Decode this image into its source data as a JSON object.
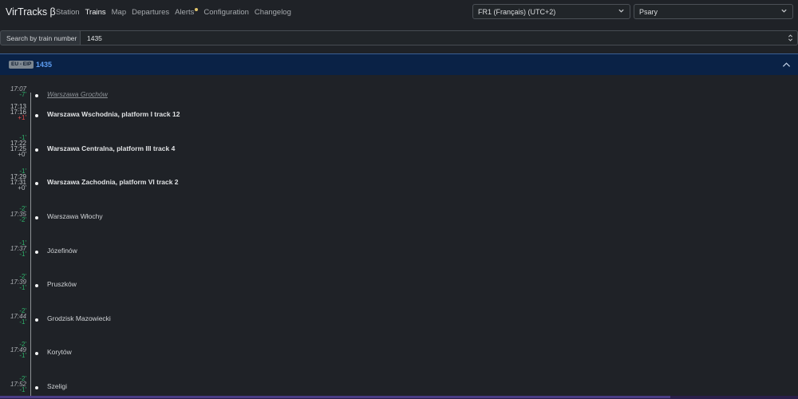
{
  "nav": {
    "brand": "VirTracks β",
    "links": [
      "Station",
      "Trains",
      "Map",
      "Departures",
      "Alerts",
      "Configuration",
      "Changelog"
    ],
    "active": "Trains"
  },
  "selects": {
    "timezone": "FR1 (Français) (UTC+2)",
    "station": "Psary"
  },
  "search": {
    "label": "Search by train number",
    "value": "1435"
  },
  "train": {
    "badge": "EU - EIP",
    "number": "1435"
  },
  "stops": [
    {
      "name": "Warszawa Grochów",
      "style": "ital",
      "times": [
        {
          "v": "17:07",
          "c": "ital"
        },
        {
          "v": "-7'",
          "c": "d-green"
        }
      ]
    },
    {
      "name": "Warszawa Wschodnia, platform I track 12",
      "style": "bold",
      "times": [
        {
          "v": "17:13",
          "c": ""
        },
        {
          "v": "17:16",
          "c": ""
        },
        {
          "v": "+1'",
          "c": "d-red"
        }
      ]
    },
    {
      "name": "Warszawa Centralna, platform III track 4",
      "style": "bold",
      "times": [
        {
          "v": "-1'",
          "c": "d-green"
        },
        {
          "v": "17:22",
          "c": ""
        },
        {
          "v": "17:25",
          "c": ""
        },
        {
          "v": "+0'",
          "c": "d-gray"
        }
      ]
    },
    {
      "name": "Warszawa Zachodnia, platform VI track 2",
      "style": "bold",
      "times": [
        {
          "v": "-1'",
          "c": "d-green"
        },
        {
          "v": "17:29",
          "c": ""
        },
        {
          "v": "17:31",
          "c": ""
        },
        {
          "v": "+0'",
          "c": "d-gray"
        }
      ]
    },
    {
      "name": "Warszawa Włochy",
      "style": "",
      "times": [
        {
          "v": "-2'",
          "c": "d-green"
        },
        {
          "v": "17:35",
          "c": "ital"
        },
        {
          "v": "-2'",
          "c": "d-green"
        }
      ]
    },
    {
      "name": "Józefinów",
      "style": "",
      "times": [
        {
          "v": "-1'",
          "c": "d-green"
        },
        {
          "v": "17:37",
          "c": "ital"
        },
        {
          "v": "-1'",
          "c": "d-green"
        }
      ]
    },
    {
      "name": "Pruszków",
      "style": "",
      "times": [
        {
          "v": "-2'",
          "c": "d-green"
        },
        {
          "v": "17:39",
          "c": "ital"
        },
        {
          "v": "-1'",
          "c": "d-green"
        }
      ]
    },
    {
      "name": "Grodzisk Mazowiecki",
      "style": "",
      "times": [
        {
          "v": "-2'",
          "c": "d-green"
        },
        {
          "v": "17:44",
          "c": "ital"
        },
        {
          "v": "-1'",
          "c": "d-green"
        }
      ]
    },
    {
      "name": "Korytów",
      "style": "",
      "times": [
        {
          "v": "-2'",
          "c": "d-green"
        },
        {
          "v": "17:49",
          "c": "ital"
        },
        {
          "v": "-1'",
          "c": "d-green"
        }
      ]
    },
    {
      "name": "Szeligi",
      "style": "",
      "times": [
        {
          "v": "-2'",
          "c": "d-green"
        },
        {
          "v": "17:52",
          "c": "ital"
        },
        {
          "v": "-1'",
          "c": "d-green"
        }
      ]
    }
  ]
}
